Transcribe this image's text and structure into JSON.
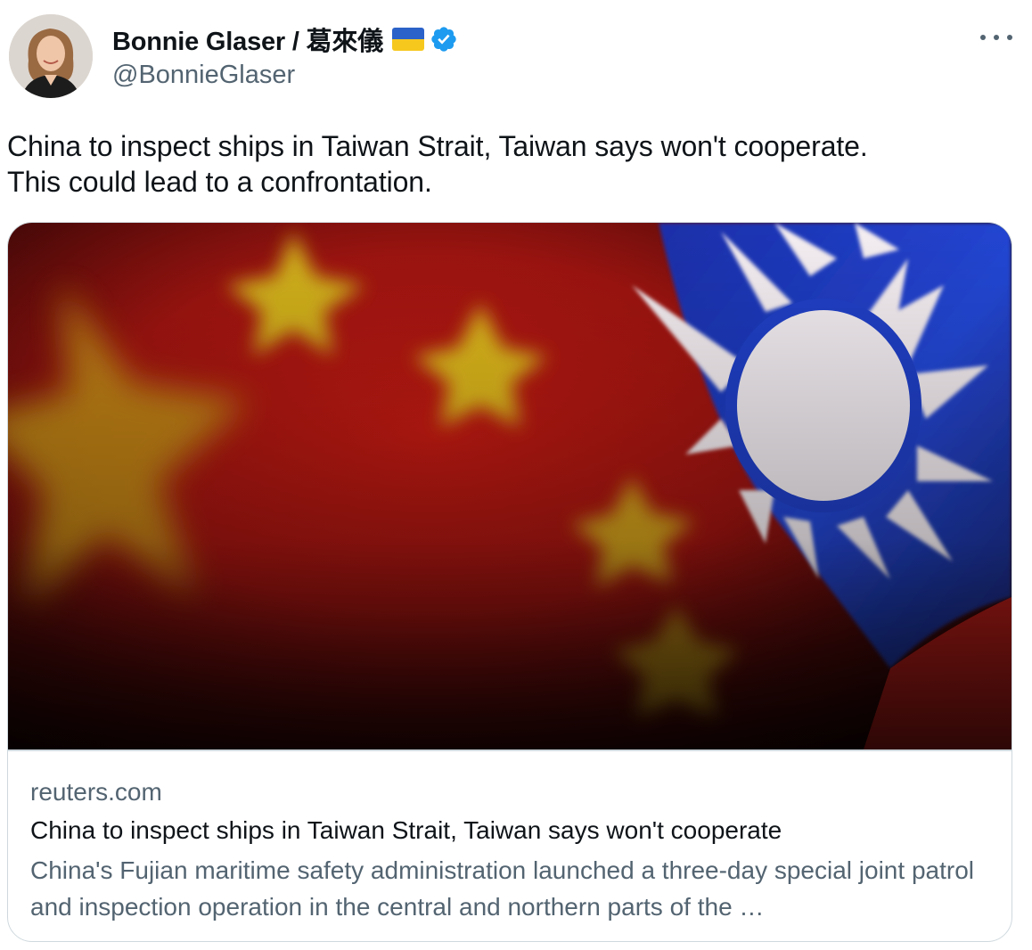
{
  "author": {
    "display_name": "Bonnie Glaser / 葛來儀",
    "handle": "@BonnieGlaser",
    "avatar_icon": "avatar-photo",
    "flag_icon": "ukraine-flag-icon",
    "verified_icon": "verified-badge-icon",
    "verified_color": "#1d9bf0"
  },
  "menu": {
    "icon": "more-options-icon"
  },
  "tweet": {
    "text": "China to inspect ships in Taiwan Strait, Taiwan says won't cooperate.\nThis could lead to a confrontation."
  },
  "link_card": {
    "image": "china-and-taiwan-flags-photo",
    "domain": "reuters.com",
    "title": "China to inspect ships in Taiwan Strait, Taiwan says won't cooperate",
    "description": "China's Fujian maritime safety administration launched a three-day special joint patrol and inspection operation in the central and northern parts of the …"
  },
  "colors": {
    "text_primary": "#0f1419",
    "text_secondary": "#536471",
    "border": "#cfd9de"
  }
}
